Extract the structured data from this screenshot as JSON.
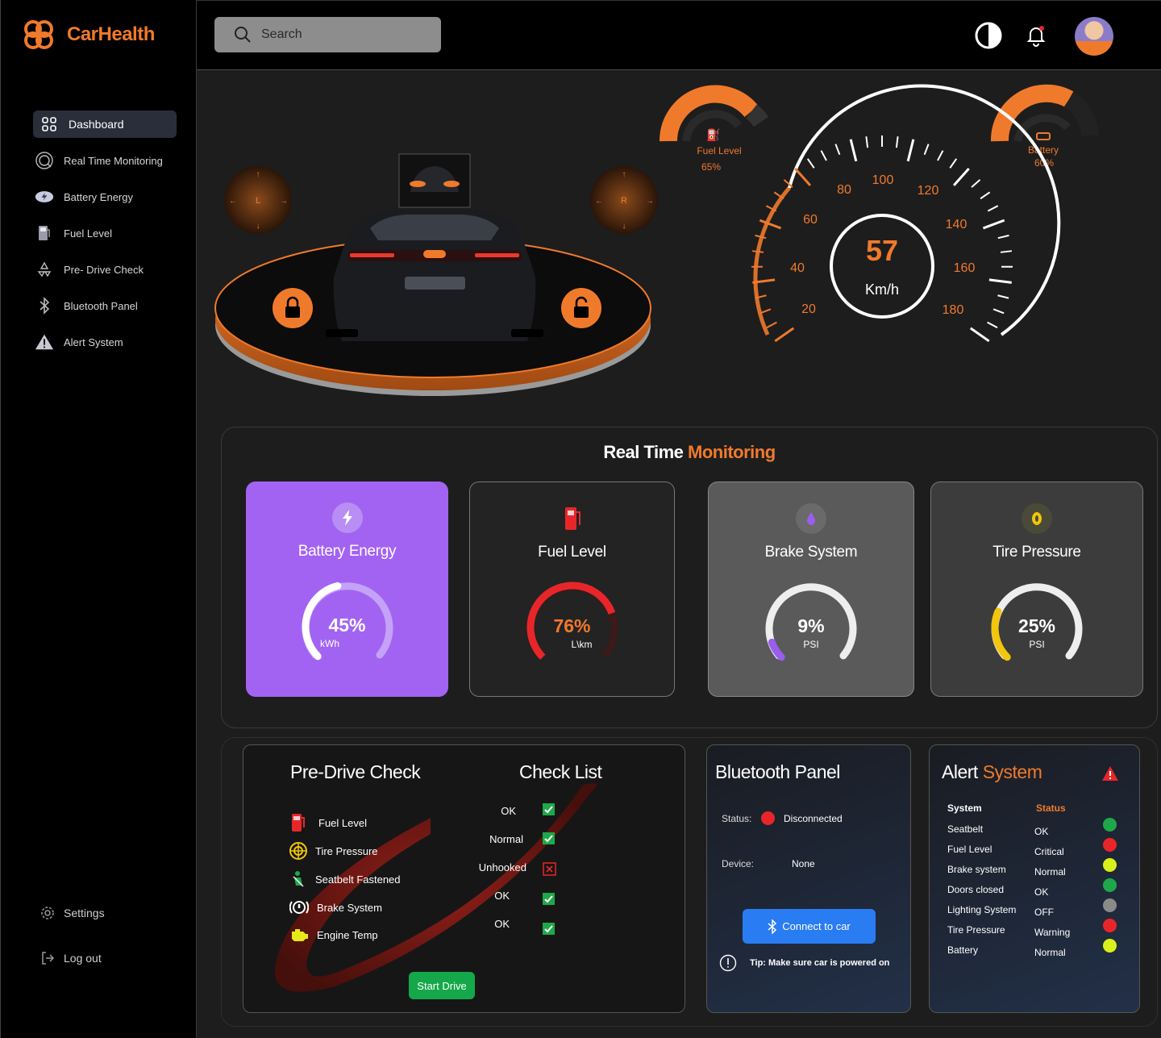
{
  "brand": {
    "name": "CarHealth",
    "accent": "#f07a2c"
  },
  "sidebar": {
    "items": [
      {
        "label": "Dashboard",
        "icon": "grid-icon"
      },
      {
        "label": "Real Time Monitoring",
        "icon": "monitor-icon"
      },
      {
        "label": "Battery Energy",
        "icon": "battery-icon"
      },
      {
        "label": "Fuel Level",
        "icon": "fuel-icon"
      },
      {
        "label": "Pre- Drive Check",
        "icon": "recycle-icon"
      },
      {
        "label": "Bluetooth Panel",
        "icon": "bluetooth-icon"
      },
      {
        "label": "Alert System",
        "icon": "warning-icon"
      }
    ],
    "settings": "Settings",
    "logout": "Log out"
  },
  "search": {
    "placeholder": "Search"
  },
  "hero": {
    "left_control": "L",
    "right_control": "R",
    "fuel_gauge": {
      "label": "Fuel Level",
      "value": "65%"
    },
    "battery_gauge": {
      "label": "Battery",
      "value": "60%"
    },
    "speed": {
      "value": "57",
      "unit": "Km/h",
      "ticks": [
        "20",
        "40",
        "60",
        "80",
        "100",
        "120",
        "140",
        "160",
        "180"
      ]
    }
  },
  "rtm": {
    "title_a": "Real Time ",
    "title_b": "Monitoring",
    "cards": [
      {
        "title": "Battery Energy",
        "value": "45%",
        "unit": "kWh",
        "level": 0.45
      },
      {
        "title": "Fuel Level",
        "value": "76%",
        "unit": "L\\km",
        "level": 0.76
      },
      {
        "title": "Brake System",
        "value": "9%",
        "unit": "PSI",
        "level": 0.09
      },
      {
        "title": "Tire Pressure",
        "value": "25%",
        "unit": "PSI",
        "level": 0.25
      }
    ]
  },
  "pre_drive": {
    "title": "Pre-Drive Check",
    "checklist_title": "Check List",
    "items": [
      {
        "label": "Fuel Level",
        "status": "OK",
        "passed": true
      },
      {
        "label": "Tire Pressure",
        "status": "Normal",
        "passed": true
      },
      {
        "label": "Seatbelt Fastened",
        "status": "Unhooked",
        "passed": false
      },
      {
        "label": "Brake System",
        "status": "OK",
        "passed": true
      },
      {
        "label": "Engine Temp",
        "status": "OK",
        "passed": true
      }
    ],
    "start_button": "Start Drive"
  },
  "bluetooth": {
    "title": "Bluetooth Panel",
    "status_label": "Status:",
    "status_value": "Disconnected",
    "device_label": "Device:",
    "device_value": "None",
    "connect_button": "Connect to car",
    "tip": "Tip: Make sure car is powered on"
  },
  "alert": {
    "title_a": "Alert ",
    "title_b": "System",
    "col_system": "System",
    "col_status": "Status",
    "rows": [
      {
        "system": "Seatbelt",
        "status": "OK",
        "color": "#1fa84a"
      },
      {
        "system": "Fuel Level",
        "status": "Critical",
        "color": "#e8262a"
      },
      {
        "system": "Brake system",
        "status": "Normal",
        "color": "#d9f01a"
      },
      {
        "system": "Doors closed",
        "status": "OK",
        "color": "#1fa84a"
      },
      {
        "system": "Lighting System",
        "status": "OFF",
        "color": "#8a8a8a"
      },
      {
        "system": "Tire Pressure",
        "status": "Warning",
        "color": "#e8262a"
      },
      {
        "system": "Battery",
        "status": "Normal",
        "color": "#d9f01a"
      }
    ]
  }
}
